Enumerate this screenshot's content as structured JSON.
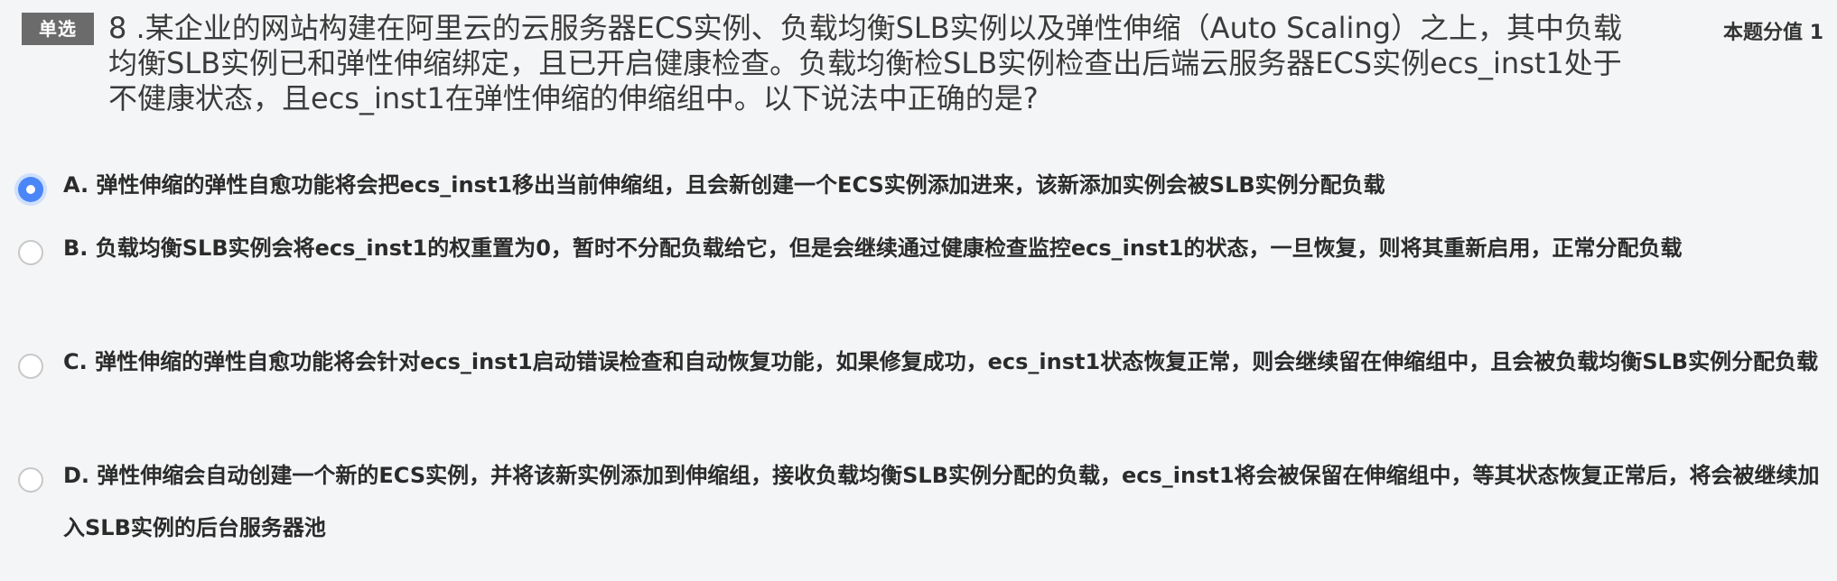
{
  "question": {
    "type_badge": "单选",
    "text": "8 .某企业的网站构建在阿里云的云服务器ECS实例、负载均衡SLB实例以及弹性伸缩（Auto Scaling）之上，其中负载均衡SLB实例已和弹性伸缩绑定，且已开启健康检查。负载均衡检SLB实例检查出后端云服务器ECS实例ecs_inst1处于不健康状态，且ecs_inst1在弹性伸缩的伸缩组中。以下说法中正确的是?",
    "score_label": "本题分值 1"
  },
  "options": [
    {
      "label": "A. 弹性伸缩的弹性自愈功能将会把ecs_inst1移出当前伸缩组，且会新创建一个ECS实例添加进来，该新添加实例会被SLB实例分配负载",
      "selected": true
    },
    {
      "label": "B. 负载均衡SLB实例会将ecs_inst1的权重置为0，暂时不分配负载给它，但是会继续通过健康检查监控ecs_inst1的状态，一旦恢复，则将其重新启用，正常分配负载",
      "selected": false
    },
    {
      "label": "C. 弹性伸缩的弹性自愈功能将会针对ecs_inst1启动错误检查和自动恢复功能，如果修复成功，ecs_inst1状态恢复正常，则会继续留在伸缩组中，且会被负载均衡SLB实例分配负载",
      "selected": false
    },
    {
      "label": "D. 弹性伸缩会自动创建一个新的ECS实例，并将该新实例添加到伸缩组，接收负载均衡SLB实例分配的负载，ecs_inst1将会被保留在伸缩组中，等其状态恢复正常后，将会被继续加入SLB实例的后台服务器池",
      "selected": false
    }
  ],
  "colors": {
    "accent": "#4a86f7",
    "badge_bg": "#6b6b6b",
    "background": "#f4f5f6"
  }
}
